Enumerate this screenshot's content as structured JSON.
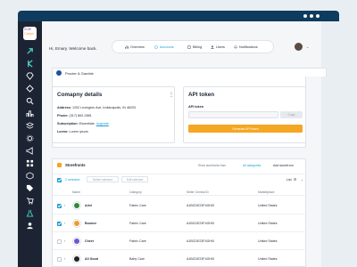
{
  "header": {
    "welcome": "Hi, Emary. Welcome back.",
    "nav": [
      {
        "label": "Overview",
        "icon": "bar-chart-icon"
      },
      {
        "label": "Accounts",
        "icon": "accounts-icon",
        "active": true
      },
      {
        "label": "Billing",
        "icon": "billing-icon"
      },
      {
        "label": "Users",
        "icon": "users-icon"
      },
      {
        "label": "Notifications",
        "icon": "notifications-icon"
      }
    ]
  },
  "logo": {
    "line1": "ZOE",
    "line2": "Cofyd"
  },
  "company": {
    "name": "Procter & Gamble"
  },
  "details": {
    "title": "Comapny details",
    "address_label": "Address:",
    "address": "1202 Lexington Ave, Indianapolis, IN 46203",
    "phone_label": "Phone:",
    "phone": "(317) 862-2881",
    "subscription_label": "Subscription:",
    "subscription": "Essentials",
    "upgrade": "Upgrade",
    "lorem_label": "Lorem:",
    "lorem": "Lorem ipsum"
  },
  "api": {
    "title": "API token",
    "label": "API token",
    "copy": "Copy",
    "generate": "Generate API token"
  },
  "storefronts": {
    "title": "Storefronts",
    "show_label": "Show storefronts from",
    "categories": "All categories",
    "add": "Add storefront",
    "selected": "2 selected",
    "delete": "Delete selected",
    "edit": "Edit selected",
    "list": "List",
    "columns": [
      "Name",
      "Category",
      "Seller Central ID",
      "Marketplace"
    ],
    "rows": [
      {
        "name": "Ariel",
        "category": "Fabric Care",
        "id": "A1BCDE23F4GHI0",
        "marketplace": "United States",
        "color": "#2e8b3a",
        "checked": true
      },
      {
        "name": "Bounce",
        "category": "Fabric Care",
        "id": "A1BCDE23F4GHI0",
        "marketplace": "United States",
        "color": "#f29c2b",
        "checked": true
      },
      {
        "name": "Cheer",
        "category": "Fabric Care",
        "id": "A1BCDE23F4GHI0",
        "marketplace": "United States",
        "color": "#6a5acd",
        "checked": false
      },
      {
        "name": "All Good",
        "category": "Baby Care",
        "id": "A1BCDE23F4GHI0",
        "marketplace": "United States",
        "color": "#222222",
        "checked": false
      }
    ]
  }
}
